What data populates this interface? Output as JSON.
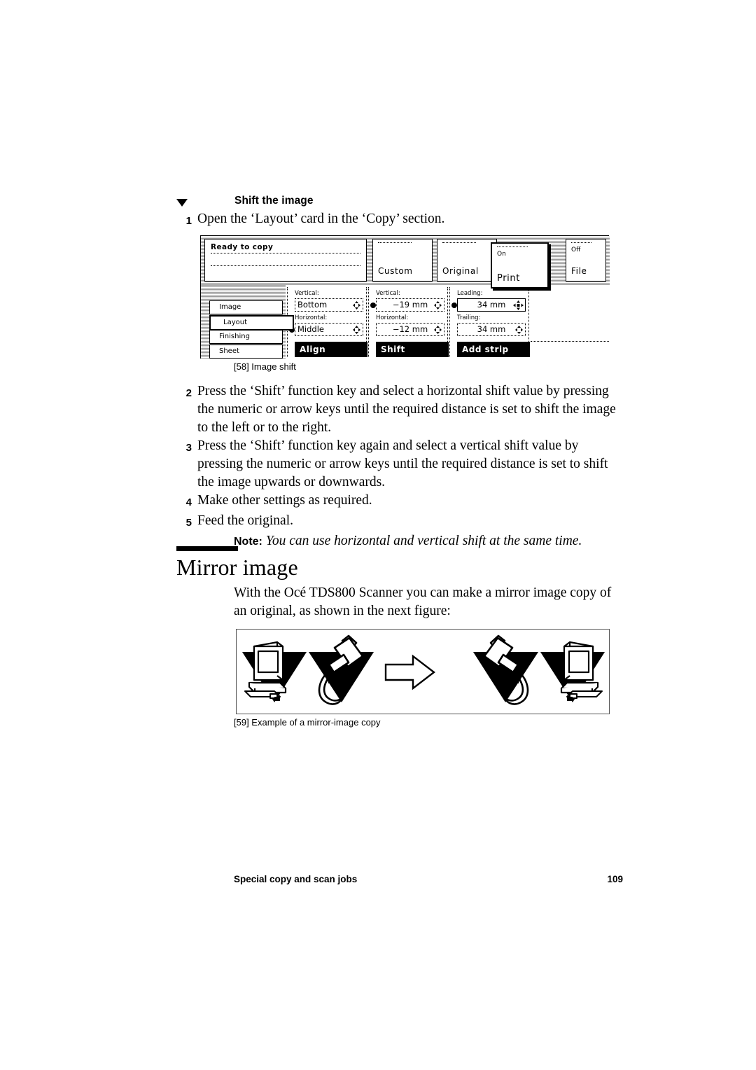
{
  "section": {
    "marker_icon": "triangle-down-icon",
    "heading": "Shift the image"
  },
  "steps_top": [
    {
      "num": "1",
      "text": "Open the ‘Layout’ card in the ‘Copy’ section."
    }
  ],
  "panel": {
    "status": {
      "title": "Ready to copy"
    },
    "top_cards": [
      {
        "id": "custom",
        "small": "",
        "main": "Custom",
        "selected": false
      },
      {
        "id": "original",
        "small": "",
        "main": "Original",
        "selected": false
      },
      {
        "id": "print",
        "small": "On",
        "main": "Print",
        "selected": true
      },
      {
        "id": "file",
        "small": "Off",
        "main": "File",
        "selected": false
      }
    ],
    "sidebar": [
      {
        "id": "image",
        "label": "Image",
        "selected": false
      },
      {
        "id": "layout",
        "label": "Layout",
        "selected": true
      },
      {
        "id": "finishing",
        "label": "Finishing",
        "selected": false
      },
      {
        "id": "sheet",
        "label": "Sheet",
        "selected": false
      }
    ],
    "columns": [
      {
        "id": "align",
        "footer": "Align",
        "fields": [
          {
            "label": "Vertical:",
            "value": "Bottom",
            "bullet": false,
            "active": false,
            "align": "left",
            "spinner": "spinner-updown-icon"
          },
          {
            "label": "Horizontal:",
            "value": "Middle",
            "bullet": true,
            "active": false,
            "align": "left",
            "spinner": "spinner-updown-icon"
          }
        ]
      },
      {
        "id": "shift",
        "footer": "Shift",
        "fields": [
          {
            "label": "Vertical:",
            "value": "−19 mm",
            "bullet": true,
            "active": false,
            "align": "center",
            "spinner": "spinner-updown-icon"
          },
          {
            "label": "Horizontal:",
            "value": "−12 mm",
            "bullet": false,
            "active": false,
            "align": "center",
            "spinner": "spinner-updown-icon"
          }
        ]
      },
      {
        "id": "addstrip",
        "footer": "Add strip",
        "fields": [
          {
            "label": "Leading:",
            "value": "34 mm",
            "bullet": true,
            "active": true,
            "align": "center",
            "spinner": "spinner-fourway-icon"
          },
          {
            "label": "Trailing:",
            "value": "34 mm",
            "bullet": false,
            "active": false,
            "align": "center",
            "spinner": "spinner-updown-icon"
          }
        ]
      }
    ]
  },
  "figure58": {
    "caption": "[58] Image shift"
  },
  "steps_bottom": [
    {
      "num": "2",
      "text": "Press the ‘Shift’ function key and select a horizontal shift value by pressing the numeric or arrow keys until the required distance is set to shift the image to the left or to the right."
    },
    {
      "num": "3",
      "text": "Press the ‘Shift’ function key again and select a vertical shift value by pressing the numeric or arrow keys until the required distance is set to shift the image upwards or downwards."
    },
    {
      "num": "4",
      "text": "Make other settings as required."
    },
    {
      "num": "5",
      "text": "Feed the original."
    }
  ],
  "note": {
    "label": "Note:",
    "text": "You can use horizontal and vertical shift at the same time."
  },
  "chapter": {
    "title": "Mirror image",
    "intro": "With the Océ TDS800 Scanner you can make a mirror image copy of an original, as shown in the next figure:"
  },
  "figure59": {
    "caption": "[59] Example of a mirror-image copy",
    "icons": {
      "left_group": [
        "computer-icon",
        "mouse-icon"
      ],
      "arrow": "arrow-right-icon",
      "right_group": [
        "mouse-icon-mirrored",
        "computer-icon-mirrored"
      ]
    }
  },
  "footer": {
    "left": "Special copy and scan jobs",
    "page": "109"
  }
}
